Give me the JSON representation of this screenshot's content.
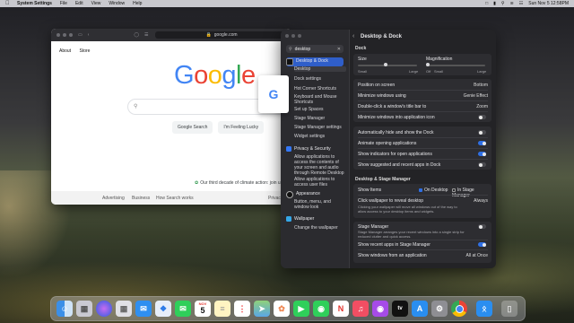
{
  "menubar": {
    "app": "System Settings",
    "items": [
      "File",
      "Edit",
      "View",
      "Window",
      "Help"
    ],
    "datetime": "Sun Nov 5 12:58PM"
  },
  "chrome": {
    "url": "google.com",
    "nav_left": [
      "About",
      "Store"
    ],
    "btn_search": "Google Search",
    "btn_lucky": "I'm Feeling Lucky",
    "climate_text": "Our third decade of climate action: join us",
    "footer": [
      "Advertising",
      "Business",
      "How Search works",
      "Privacy"
    ],
    "logo": "Google"
  },
  "settings": {
    "search_value": "desktop",
    "pane_title": "Desktop & Dock",
    "sidebar": {
      "desktop_dock": "Desktop & Dock",
      "subs": [
        "Desktop",
        "Dock settings",
        "Hot Corner Shortcuts",
        "Keyboard and Mouse Shortcuts",
        "Set up Spaces",
        "Stage Manager",
        "Stage Manager settings",
        "Widget settings"
      ],
      "privacy": "Privacy & Security",
      "privacy_subs": [
        "Allow applications to access the contents of your screen and audio through Remote Desktop",
        "Allow applications to access user files"
      ],
      "appearance": "Appearance",
      "appearance_subs": [
        "Button, menu, and window look"
      ],
      "wallpaper": "Wallpaper",
      "wallpaper_subs": [
        "Change the wallpaper"
      ]
    },
    "dock": {
      "section": "Dock",
      "size_label": "Size",
      "mag_label": "Magnification",
      "small": "Small",
      "large": "Large",
      "off": "Off",
      "small2": "Small",
      "large2": "Large",
      "position_label": "Position on screen",
      "position_value": "Bottom",
      "minimize_label": "Minimize windows using",
      "minimize_value": "Genie Effect",
      "doubleclick_label": "Double-click a window's title bar to",
      "doubleclick_value": "Zoom",
      "minimize_icon_label": "Minimize windows into application icon",
      "autohide_label": "Automatically hide and show the Dock",
      "animate_label": "Animate opening applications",
      "indicators_label": "Show indicators for open applications",
      "recent_label": "Show suggested and recent apps in Dock"
    },
    "stage": {
      "section": "Desktop & Stage Manager",
      "show_items": "Show Items",
      "on_desktop": "On Desktop",
      "in_stage": "In Stage Manager",
      "click_wallpaper": "Click wallpaper to reveal desktop",
      "click_value": "Always",
      "click_desc": "Clicking your wallpaper will move all windows out of the way to allow access to your desktop items and widgets.",
      "sm_label": "Stage Manager",
      "sm_desc": "Stage Manager arranges your recent windows into a single strip for reduced clutter and quick access.",
      "recent_sm": "Show recent apps in Stage Manager",
      "show_windows": "Show windows from an application",
      "show_windows_value": "All at Once"
    }
  },
  "colors": {
    "accent": "#2f6fe4",
    "google_blue": "#4285f4",
    "google_red": "#ea4335",
    "google_yellow": "#fbbc05",
    "google_green": "#34a853"
  },
  "dock_icons": [
    "finder-icon",
    "launchpad-icon",
    "siri-icon",
    "photos-icon",
    "mail-icon",
    "safari-icon",
    "messages-icon",
    "calendar-icon",
    "notes-icon",
    "reminders-icon",
    "maps-icon",
    "photos-app-icon",
    "facetime-icon",
    "messages-app-icon",
    "news-icon",
    "music-icon",
    "podcasts-icon",
    "appletv-icon",
    "appstore-icon",
    "settings-icon",
    "chrome-icon",
    "bluetooth-icon",
    "trash-icon"
  ],
  "dock_calendar": {
    "day": "5",
    "month": "NOV"
  }
}
